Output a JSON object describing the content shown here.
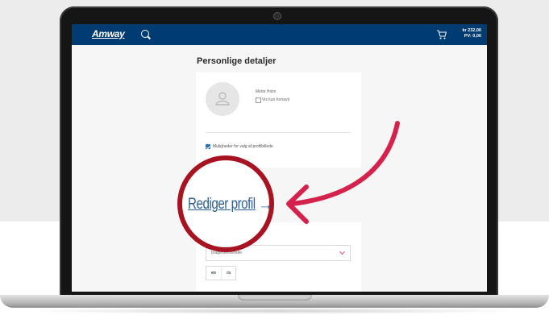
{
  "header": {
    "logo": "Amway",
    "cart_amount": "kr 232,00",
    "cart_pv": "PV: 0,00"
  },
  "page": {
    "title": "Personlige detaljer"
  },
  "profile": {
    "name": "Mette Holm",
    "show_first_name_label": "Vis kun fornavn",
    "profile_picture_option_label": "Muligheder for valg af profilbillede"
  },
  "language_section": {
    "select_value": "brugerdefinerede",
    "languages": [
      {
        "code": "en",
        "active": true
      },
      {
        "code": "da",
        "active": false
      }
    ]
  },
  "callout": {
    "edit_profile_label": "Rediger profil",
    "arrow_glyph": "→",
    "highlight_color": "#a81322",
    "pointer_color": "#d4224d"
  },
  "colors": {
    "brand_header": "#003b71",
    "link": "#2d5f98",
    "checkbox": "#1f6fb5"
  }
}
